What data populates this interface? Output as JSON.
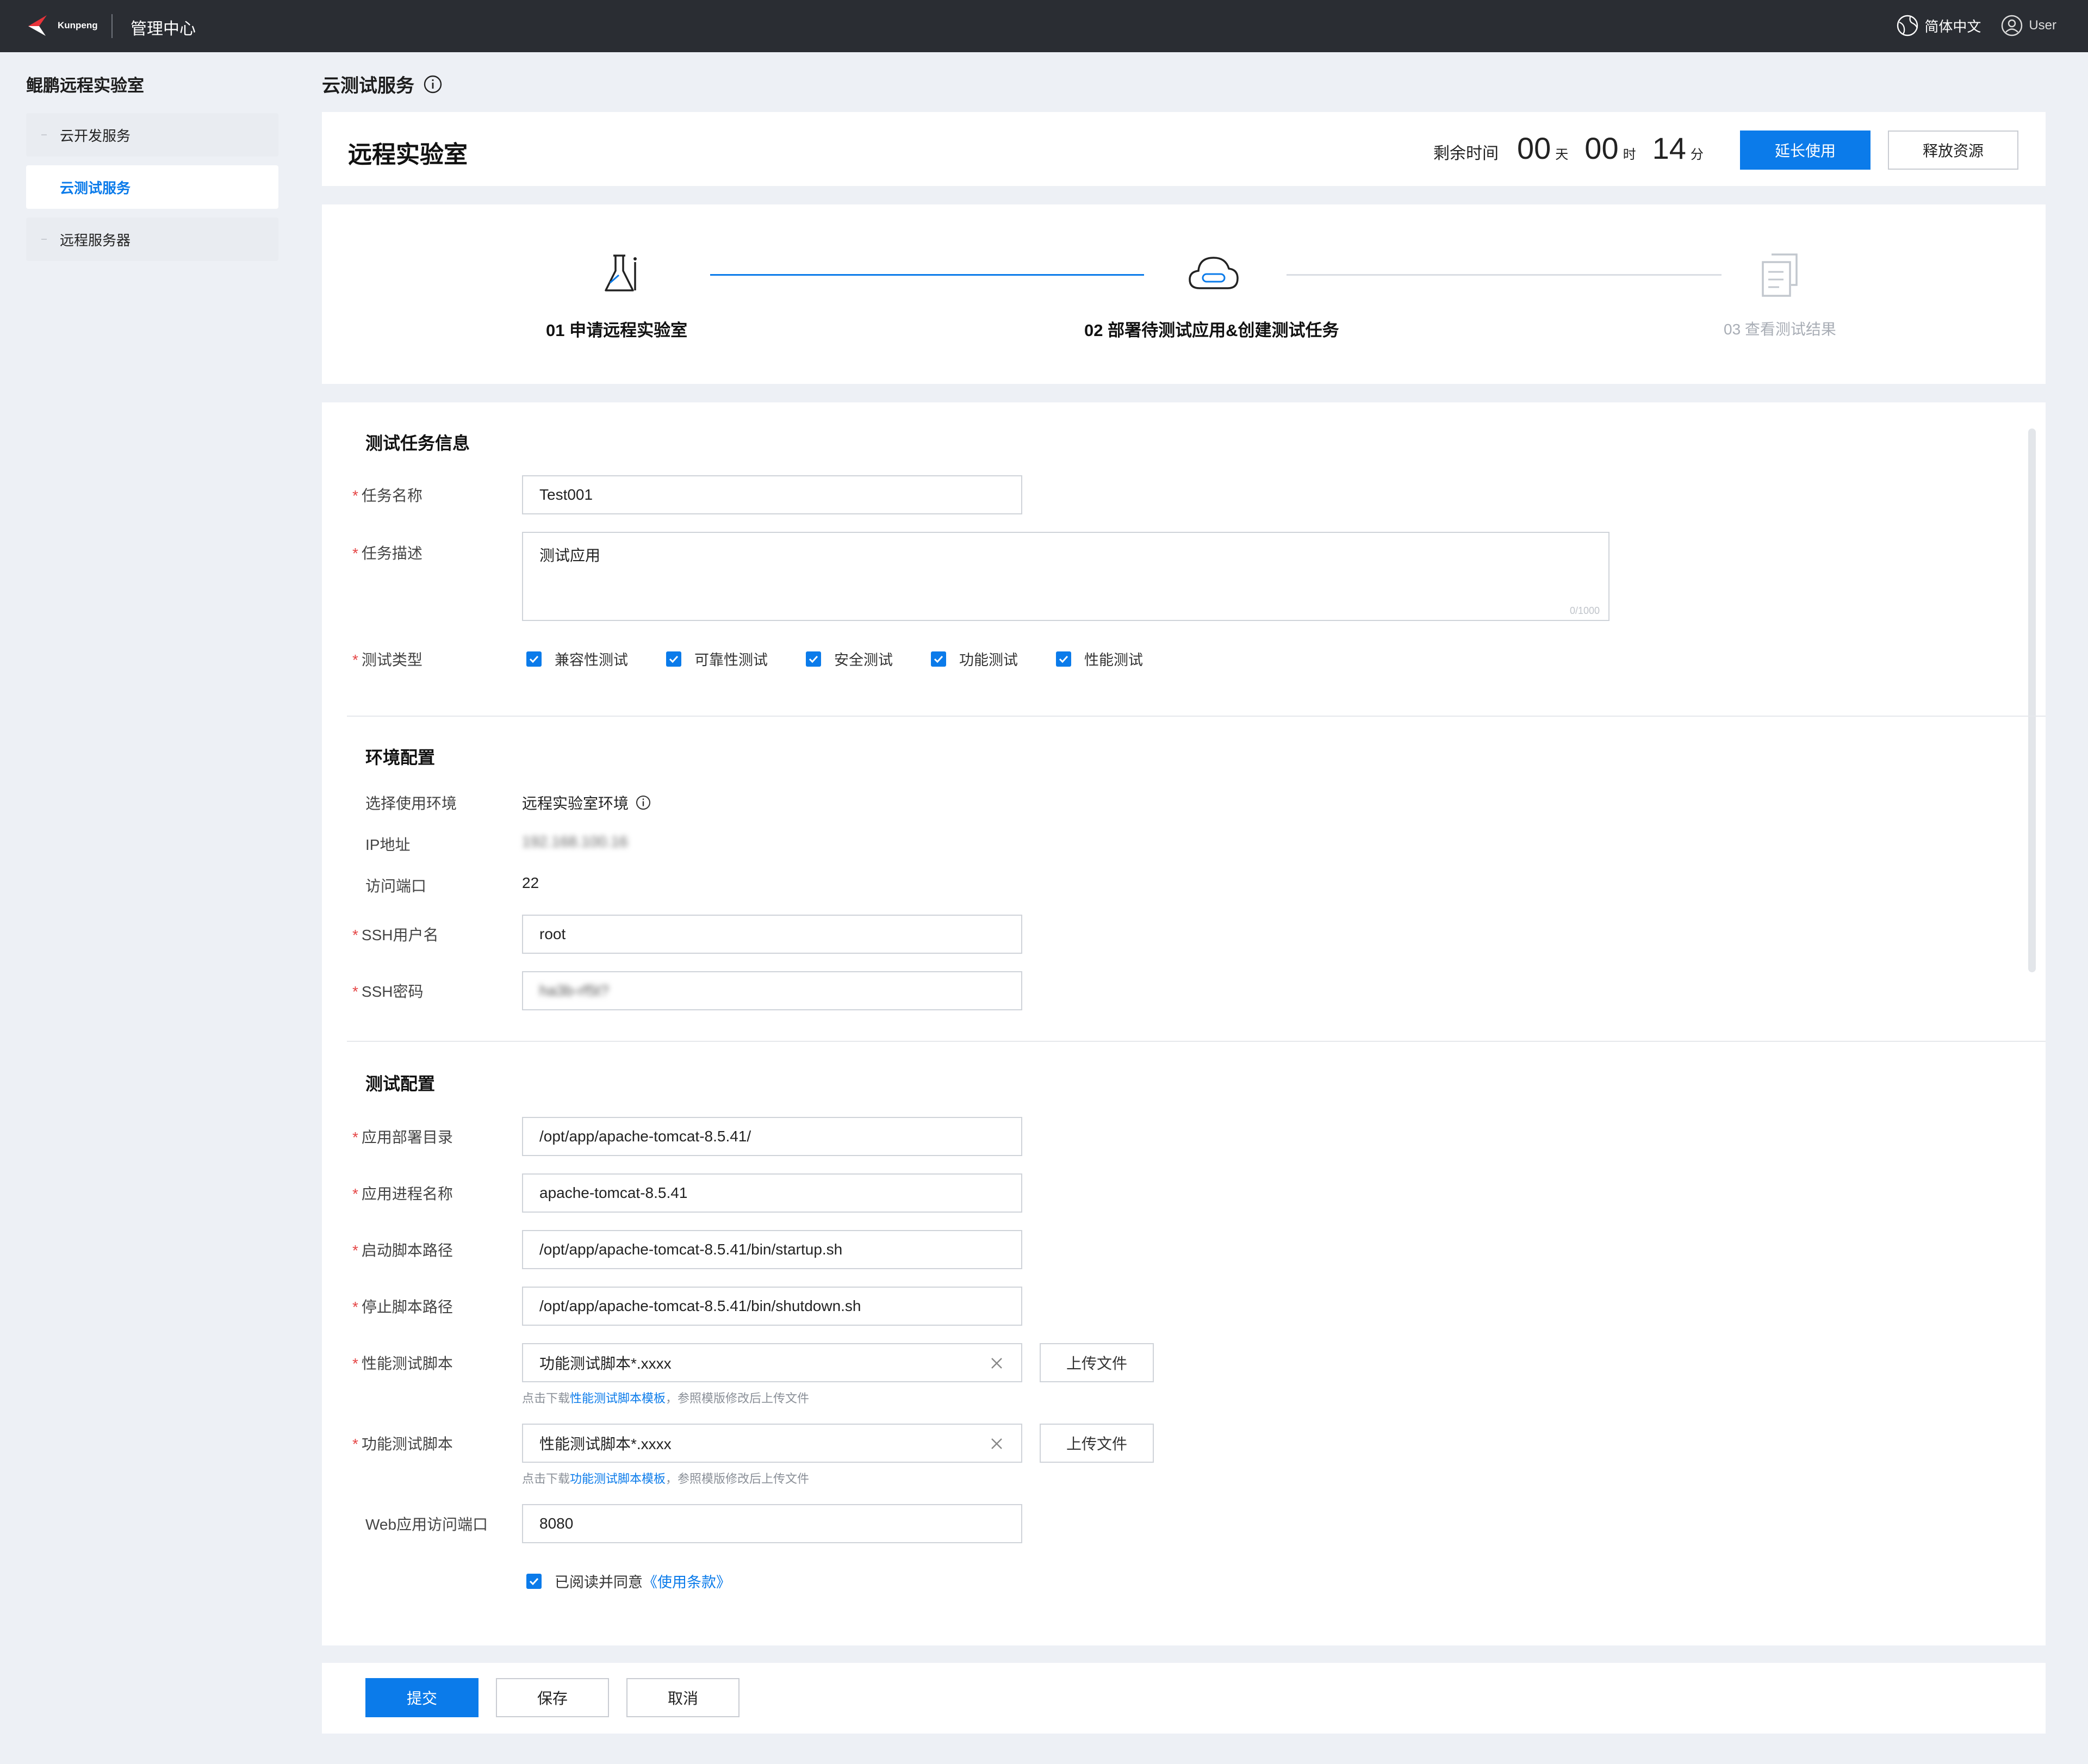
{
  "topbar": {
    "logo_text": "Kunpeng",
    "app_title": "管理中心",
    "language": "简体中文",
    "user": "User"
  },
  "sidebar": {
    "title": "鲲鹏远程实验室",
    "items": [
      {
        "label": "云开发服务",
        "active": false
      },
      {
        "label": "云测试服务",
        "active": true
      },
      {
        "label": "远程服务器",
        "active": false
      }
    ]
  },
  "page": {
    "title": "云测试服务"
  },
  "lab": {
    "title": "远程实验室",
    "remaining_label": "剩余时间",
    "days": "00",
    "days_unit": "天",
    "hours": "00",
    "hours_unit": "时",
    "minutes": "14",
    "minutes_unit": "分",
    "extend_label": "延长使用",
    "release_label": "释放资源"
  },
  "steps": [
    {
      "label": "01 申请远程实验室",
      "state": "done"
    },
    {
      "label": "02 部署待测试应用&创建测试任务",
      "state": "active"
    },
    {
      "label": "03 查看测试结果",
      "state": "pending"
    }
  ],
  "task_info": {
    "section_title": "测试任务信息",
    "name_label": "任务名称",
    "name_value": "Test001",
    "desc_label": "任务描述",
    "desc_value": "测试应用",
    "desc_counter": "0/1000",
    "type_label": "测试类型",
    "types": [
      {
        "label": "兼容性测试",
        "checked": true
      },
      {
        "label": "可靠性测试",
        "checked": true
      },
      {
        "label": "安全测试",
        "checked": true
      },
      {
        "label": "功能测试",
        "checked": true
      },
      {
        "label": "性能测试",
        "checked": true
      }
    ]
  },
  "env": {
    "section_title": "环境配置",
    "env_label": "选择使用环境",
    "env_value": "远程实验室环境",
    "ip_label": "IP地址",
    "ip_value": "192.168.100.16",
    "port_label": "访问端口",
    "port_value": "22",
    "ssh_user_label": "SSH用户名",
    "ssh_user_value": "root",
    "ssh_pwd_label": "SSH密码",
    "ssh_pwd_value": "ha3b-rf5t?"
  },
  "test_config": {
    "section_title": "测试配置",
    "deploy_dir_label": "应用部署目录",
    "deploy_dir_value": "/opt/app/apache-tomcat-8.5.41/",
    "process_label": "应用进程名称",
    "process_value": "apache-tomcat-8.5.41",
    "start_label": "启动脚本路径",
    "start_value": "/opt/app/apache-tomcat-8.5.41/bin/startup.sh",
    "stop_label": "停止脚本路径",
    "stop_value": "/opt/app/apache-tomcat-8.5.41/bin/shutdown.sh",
    "perf_label": "性能测试脚本",
    "perf_value": "功能测试脚本*.xxxx",
    "perf_hint_prefix": "点击下载",
    "perf_hint_link": "性能测试脚本模板",
    "perf_hint_suffix": "，参照模版修改后上传文件",
    "func_label": "功能测试脚本",
    "func_value": "性能测试脚本*.xxxx",
    "func_hint_prefix": "点击下载",
    "func_hint_link": "功能测试脚本模板",
    "func_hint_suffix": "，参照模版修改后上传文件",
    "upload_label": "上传文件",
    "web_port_label": "Web应用访问端口",
    "web_port_value": "8080",
    "agree_text": "已阅读并同意",
    "agree_link": "《使用条款》"
  },
  "footer": {
    "submit_label": "提交",
    "save_label": "保存",
    "cancel_label": "取消"
  },
  "colors": {
    "primary": "#0b7bea",
    "topbar": "#2a2d33",
    "required": "#e54545",
    "background": "#edf0f5"
  }
}
